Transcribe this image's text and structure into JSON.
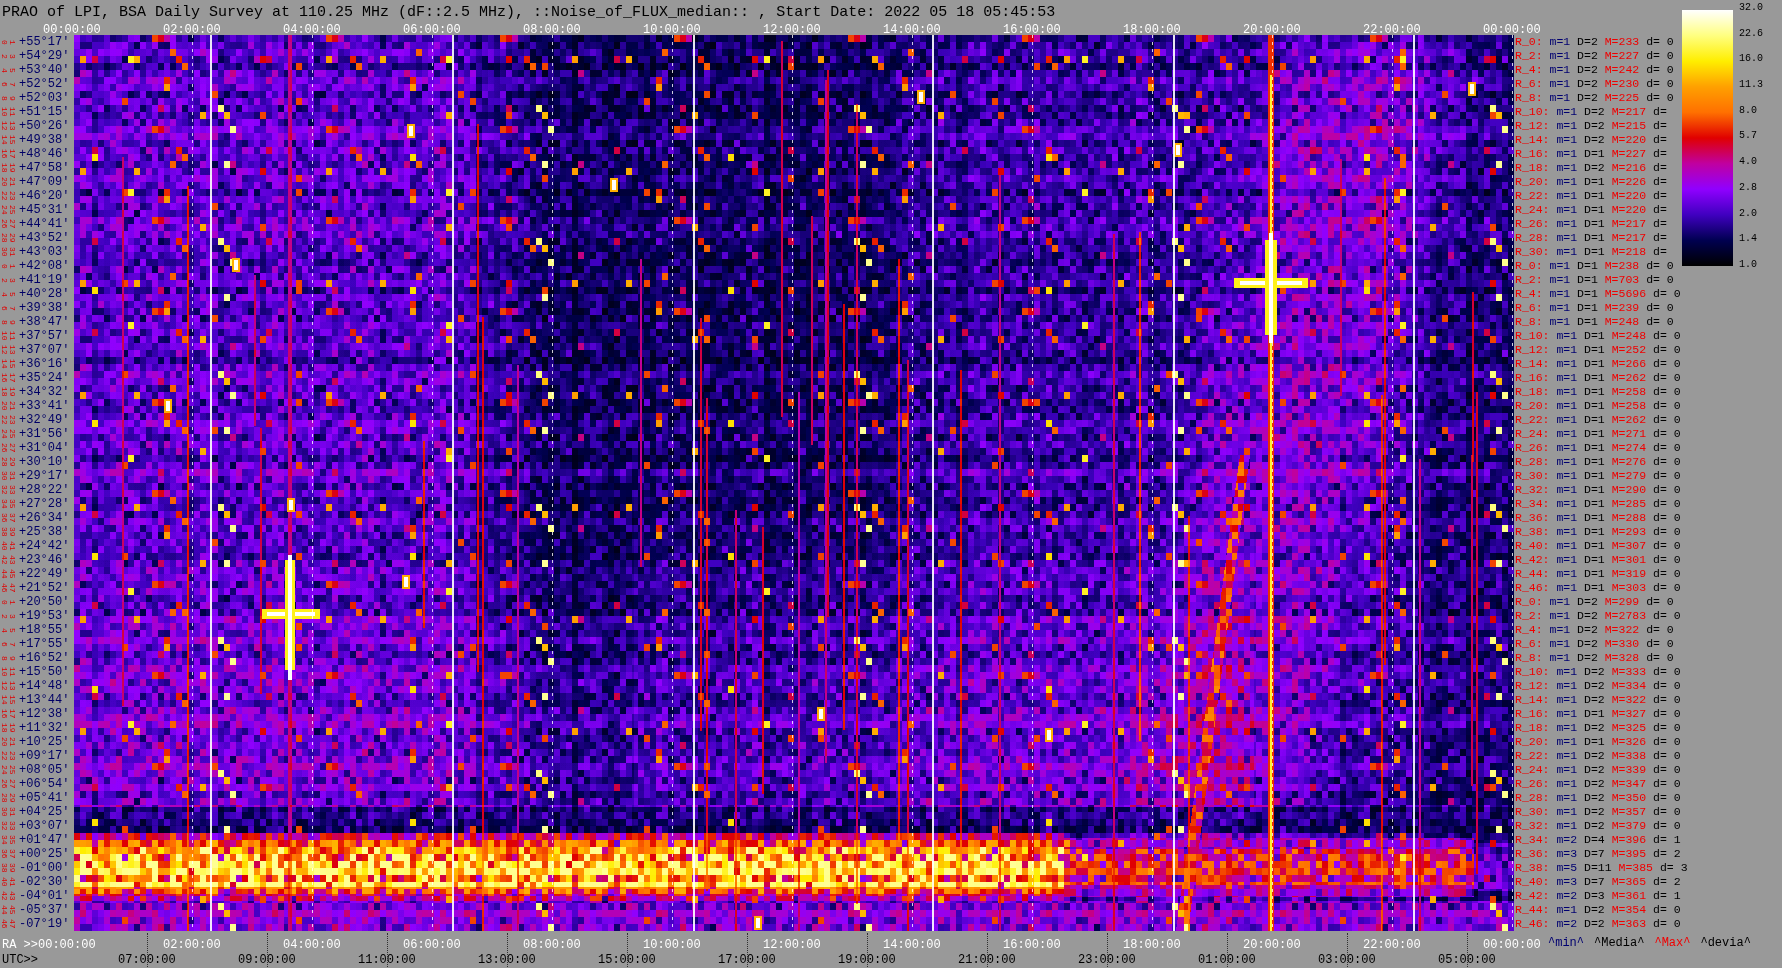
{
  "title": "PRAO of LPI, BSA Daily Survey at 110.25 MHz (dF::2.5 MHz), ::Noise_of_FLUX_median:: , Start Date: 2022 05 18 05:45:53",
  "top_axis": {
    "labels": [
      "00:00:00",
      "02:00:00",
      "04:00:00",
      "06:00:00",
      "08:00:00",
      "10:00:00",
      "12:00:00",
      "14:00:00",
      "16:00:00",
      "18:00:00",
      "20:00:00",
      "22:00:00",
      "00:00:00"
    ]
  },
  "rows": [
    {
      "numbers": [
        "0",
        "1"
      ],
      "declination": "+55°17′",
      "beam": "R_0:",
      "min": "m=1",
      "median": "D=2",
      "max": "M=233",
      "deviation": "d= 0"
    },
    {
      "numbers": [
        "2",
        "3"
      ],
      "declination": "+54°29′",
      "beam": "R_2:",
      "min": "m=1",
      "median": "D=2",
      "max": "M=227",
      "deviation": "d= 0"
    },
    {
      "numbers": [
        "4",
        "5"
      ],
      "declination": "+53°40′",
      "beam": "R_4:",
      "min": "m=1",
      "median": "D=2",
      "max": "M=242",
      "deviation": "d= 0"
    },
    {
      "numbers": [
        "6",
        "7"
      ],
      "declination": "+52°52′",
      "beam": "R_6:",
      "min": "m=1",
      "median": "D=2",
      "max": "M=230",
      "deviation": "d= 0"
    },
    {
      "numbers": [
        "8",
        "9"
      ],
      "declination": "+52°03′",
      "beam": "R_8:",
      "min": "m=1",
      "median": "D=2",
      "max": "M=225",
      "deviation": "d= 0"
    },
    {
      "numbers": [
        "10",
        "11"
      ],
      "declination": "+51°15′",
      "beam": "R_10:",
      "min": "m=1",
      "median": "D=2",
      "max": "M=217",
      "deviation": "d="
    },
    {
      "numbers": [
        "12",
        "13"
      ],
      "declination": "+50°26′",
      "beam": "R_12:",
      "min": "m=1",
      "median": "D=2",
      "max": "M=215",
      "deviation": "d="
    },
    {
      "numbers": [
        "14",
        "15"
      ],
      "declination": "+49°38′",
      "beam": "R_14:",
      "min": "m=1",
      "median": "D=2",
      "max": "M=220",
      "deviation": "d="
    },
    {
      "numbers": [
        "16",
        "17"
      ],
      "declination": "+48°46′",
      "beam": "R_16:",
      "min": "m=1",
      "median": "D=1",
      "max": "M=227",
      "deviation": "d="
    },
    {
      "numbers": [
        "18",
        "19"
      ],
      "declination": "+47°58′",
      "beam": "R_18:",
      "min": "m=1",
      "median": "D=2",
      "max": "M=216",
      "deviation": "d="
    },
    {
      "numbers": [
        "20",
        "21"
      ],
      "declination": "+47°09′",
      "beam": "R_20:",
      "min": "m=1",
      "median": "D=1",
      "max": "M=226",
      "deviation": "d="
    },
    {
      "numbers": [
        "22",
        "23"
      ],
      "declination": "+46°20′",
      "beam": "R_22:",
      "min": "m=1",
      "median": "D=1",
      "max": "M=220",
      "deviation": "d="
    },
    {
      "numbers": [
        "24",
        "25"
      ],
      "declination": "+45°31′",
      "beam": "R_24:",
      "min": "m=1",
      "median": "D=1",
      "max": "M=220",
      "deviation": "d="
    },
    {
      "numbers": [
        "26",
        "27"
      ],
      "declination": "+44°41′",
      "beam": "R_26:",
      "min": "m=1",
      "median": "D=1",
      "max": "M=217",
      "deviation": "d="
    },
    {
      "numbers": [
        "28",
        "29"
      ],
      "declination": "+43°52′",
      "beam": "R_28:",
      "min": "m=1",
      "median": "D=1",
      "max": "M=217",
      "deviation": "d="
    },
    {
      "numbers": [
        "30",
        "31"
      ],
      "declination": "+43°03′",
      "beam": "R_30:",
      "min": "m=1",
      "median": "D=1",
      "max": "M=218",
      "deviation": "d="
    },
    {
      "numbers": [
        "0",
        "1"
      ],
      "declination": "+42°08′",
      "beam": "R_0:",
      "min": "m=1",
      "median": "D=1",
      "max": "M=238",
      "deviation": "d= 0"
    },
    {
      "numbers": [
        "2",
        "3"
      ],
      "declination": "+41°19′",
      "beam": "R_2:",
      "min": "m=1",
      "median": "D=1",
      "max": "M=703",
      "deviation": "d= 0"
    },
    {
      "numbers": [
        "4",
        "5"
      ],
      "declination": "+40°28′",
      "beam": "R_4:",
      "min": "m=1",
      "median": "D=1",
      "max": "M=5696",
      "deviation": "d= 0"
    },
    {
      "numbers": [
        "6",
        "7"
      ],
      "declination": "+39°38′",
      "beam": "R_6:",
      "min": "m=1",
      "median": "D=1",
      "max": "M=239",
      "deviation": "d= 0"
    },
    {
      "numbers": [
        "8",
        "9"
      ],
      "declination": "+38°47′",
      "beam": "R_8:",
      "min": "m=1",
      "median": "D=1",
      "max": "M=248",
      "deviation": "d= 0"
    },
    {
      "numbers": [
        "10",
        "11"
      ],
      "declination": "+37°57′",
      "beam": "R_10:",
      "min": "m=1",
      "median": "D=1",
      "max": "M=248",
      "deviation": "d= 0"
    },
    {
      "numbers": [
        "12",
        "13"
      ],
      "declination": "+37°07′",
      "beam": "R_12:",
      "min": "m=1",
      "median": "D=1",
      "max": "M=252",
      "deviation": "d= 0"
    },
    {
      "numbers": [
        "14",
        "15"
      ],
      "declination": "+36°16′",
      "beam": "R_14:",
      "min": "m=1",
      "median": "D=1",
      "max": "M=266",
      "deviation": "d= 0"
    },
    {
      "numbers": [
        "16",
        "17"
      ],
      "declination": "+35°24′",
      "beam": "R_16:",
      "min": "m=1",
      "median": "D=1",
      "max": "M=262",
      "deviation": "d= 0"
    },
    {
      "numbers": [
        "18",
        "19"
      ],
      "declination": "+34°32′",
      "beam": "R_18:",
      "min": "m=1",
      "median": "D=1",
      "max": "M=258",
      "deviation": "d= 0"
    },
    {
      "numbers": [
        "20",
        "21"
      ],
      "declination": "+33°41′",
      "beam": "R_20:",
      "min": "m=1",
      "median": "D=1",
      "max": "M=258",
      "deviation": "d= 0"
    },
    {
      "numbers": [
        "22",
        "23"
      ],
      "declination": "+32°49′",
      "beam": "R_22:",
      "min": "m=1",
      "median": "D=1",
      "max": "M=262",
      "deviation": "d= 0"
    },
    {
      "numbers": [
        "24",
        "25"
      ],
      "declination": "+31°56′",
      "beam": "R_24:",
      "min": "m=1",
      "median": "D=1",
      "max": "M=271",
      "deviation": "d= 0"
    },
    {
      "numbers": [
        "26",
        "27"
      ],
      "declination": "+31°04′",
      "beam": "R_26:",
      "min": "m=1",
      "median": "D=1",
      "max": "M=274",
      "deviation": "d= 0"
    },
    {
      "numbers": [
        "28",
        "29"
      ],
      "declination": "+30°10′",
      "beam": "R_28:",
      "min": "m=1",
      "median": "D=1",
      "max": "M=276",
      "deviation": "d= 0"
    },
    {
      "numbers": [
        "30",
        "31"
      ],
      "declination": "+29°17′",
      "beam": "R_30:",
      "min": "m=1",
      "median": "D=1",
      "max": "M=279",
      "deviation": "d= 0"
    },
    {
      "numbers": [
        "32",
        "33"
      ],
      "declination": "+28°22′",
      "beam": "R_32:",
      "min": "m=1",
      "median": "D=1",
      "max": "M=290",
      "deviation": "d= 0"
    },
    {
      "numbers": [
        "34",
        "35"
      ],
      "declination": "+27°28′",
      "beam": "R_34:",
      "min": "m=1",
      "median": "D=1",
      "max": "M=285",
      "deviation": "d= 0"
    },
    {
      "numbers": [
        "36",
        "37"
      ],
      "declination": "+26°34′",
      "beam": "R_36:",
      "min": "m=1",
      "median": "D=1",
      "max": "M=288",
      "deviation": "d= 0"
    },
    {
      "numbers": [
        "38",
        "39"
      ],
      "declination": "+25°38′",
      "beam": "R_38:",
      "min": "m=1",
      "median": "D=1",
      "max": "M=293",
      "deviation": "d= 0"
    },
    {
      "numbers": [
        "40",
        "41"
      ],
      "declination": "+24°42′",
      "beam": "R_40:",
      "min": "m=1",
      "median": "D=1",
      "max": "M=307",
      "deviation": "d= 0"
    },
    {
      "numbers": [
        "42",
        "43"
      ],
      "declination": "+23°46′",
      "beam": "R_42:",
      "min": "m=1",
      "median": "D=1",
      "max": "M=301",
      "deviation": "d= 0"
    },
    {
      "numbers": [
        "44",
        "45"
      ],
      "declination": "+22°49′",
      "beam": "R_44:",
      "min": "m=1",
      "median": "D=1",
      "max": "M=319",
      "deviation": "d= 0"
    },
    {
      "numbers": [
        "46",
        "47"
      ],
      "declination": "+21°52′",
      "beam": "R_46:",
      "min": "m=1",
      "median": "D=1",
      "max": "M=303",
      "deviation": "d= 0"
    },
    {
      "numbers": [
        "0",
        "1"
      ],
      "declination": "+20°50′",
      "beam": "R_0:",
      "min": "m=1",
      "median": "D=2",
      "max": "M=299",
      "deviation": "d= 0"
    },
    {
      "numbers": [
        "2",
        "3"
      ],
      "declination": "+19°53′",
      "beam": "R_2:",
      "min": "m=1",
      "median": "D=2",
      "max": "M=2783",
      "deviation": "d= 0"
    },
    {
      "numbers": [
        "4",
        "5"
      ],
      "declination": "+18°55′",
      "beam": "R_4:",
      "min": "m=1",
      "median": "D=2",
      "max": "M=322",
      "deviation": "d= 0"
    },
    {
      "numbers": [
        "6",
        "7"
      ],
      "declination": "+17°55′",
      "beam": "R_6:",
      "min": "m=1",
      "median": "D=2",
      "max": "M=330",
      "deviation": "d= 0"
    },
    {
      "numbers": [
        "8",
        "9"
      ],
      "declination": "+16°52′",
      "beam": "R_8:",
      "min": "m=1",
      "median": "D=2",
      "max": "M=328",
      "deviation": "d= 0"
    },
    {
      "numbers": [
        "10",
        "11"
      ],
      "declination": "+15°50′",
      "beam": "R_10:",
      "min": "m=1",
      "median": "D=2",
      "max": "M=333",
      "deviation": "d= 0"
    },
    {
      "numbers": [
        "12",
        "13"
      ],
      "declination": "+14°48′",
      "beam": "R_12:",
      "min": "m=1",
      "median": "D=2",
      "max": "M=334",
      "deviation": "d= 0"
    },
    {
      "numbers": [
        "14",
        "15"
      ],
      "declination": "+13°44′",
      "beam": "R_14:",
      "min": "m=1",
      "median": "D=2",
      "max": "M=322",
      "deviation": "d= 0"
    },
    {
      "numbers": [
        "16",
        "17"
      ],
      "declination": "+12°38′",
      "beam": "R_16:",
      "min": "m=1",
      "median": "D=1",
      "max": "M=327",
      "deviation": "d= 0"
    },
    {
      "numbers": [
        "18",
        "19"
      ],
      "declination": "+11°32′",
      "beam": "R_18:",
      "min": "m=1",
      "median": "D=2",
      "max": "M=325",
      "deviation": "d= 0"
    },
    {
      "numbers": [
        "20",
        "21"
      ],
      "declination": "+10°25′",
      "beam": "R_20:",
      "min": "m=1",
      "median": "D=1",
      "max": "M=326",
      "deviation": "d= 0"
    },
    {
      "numbers": [
        "22",
        "23"
      ],
      "declination": "+09°17′",
      "beam": "R_22:",
      "min": "m=1",
      "median": "D=2",
      "max": "M=338",
      "deviation": "d= 0"
    },
    {
      "numbers": [
        "24",
        "25"
      ],
      "declination": "+08°05′",
      "beam": "R_24:",
      "min": "m=1",
      "median": "D=2",
      "max": "M=339",
      "deviation": "d= 0"
    },
    {
      "numbers": [
        "26",
        "27"
      ],
      "declination": "+06°54′",
      "beam": "R_26:",
      "min": "m=1",
      "median": "D=2",
      "max": "M=347",
      "deviation": "d= 0"
    },
    {
      "numbers": [
        "28",
        "29"
      ],
      "declination": "+05°41′",
      "beam": "R_28:",
      "min": "m=1",
      "median": "D=2",
      "max": "M=350",
      "deviation": "d= 0"
    },
    {
      "numbers": [
        "30",
        "31"
      ],
      "declination": "+04°25′",
      "beam": "R_30:",
      "min": "m=1",
      "median": "D=2",
      "max": "M=357",
      "deviation": "d= 0"
    },
    {
      "numbers": [
        "32",
        "33"
      ],
      "declination": "+03°07′",
      "beam": "R_32:",
      "min": "m=1",
      "median": "D=2",
      "max": "M=379",
      "deviation": "d= 0"
    },
    {
      "numbers": [
        "34",
        "35"
      ],
      "declination": "+01°47′",
      "beam": "R_34:",
      "min": "m=2",
      "median": "D=4",
      "max": "M=396",
      "deviation": "d= 1"
    },
    {
      "numbers": [
        "36",
        "37"
      ],
      "declination": "+00°25′",
      "beam": "R_36:",
      "min": "m=3",
      "median": "D=7",
      "max": "M=395",
      "deviation": "d= 2"
    },
    {
      "numbers": [
        "38",
        "39"
      ],
      "declination": "-01°00′",
      "beam": "R_38:",
      "min": "m=5",
      "median": "D=11",
      "max": "M=385",
      "deviation": "d= 3"
    },
    {
      "numbers": [
        "40",
        "41"
      ],
      "declination": "-02°30′",
      "beam": "R_40:",
      "min": "m=3",
      "median": "D=7",
      "max": "M=365",
      "deviation": "d= 2"
    },
    {
      "numbers": [
        "42",
        "43"
      ],
      "declination": "-04°01′",
      "beam": "R_42:",
      "min": "m=2",
      "median": "D=3",
      "max": "M=361",
      "deviation": "d= 1"
    },
    {
      "numbers": [
        "44",
        "45"
      ],
      "declination": "-05°37′",
      "beam": "R_44:",
      "min": "m=1",
      "median": "D=2",
      "max": "M=354",
      "deviation": "d= 0"
    },
    {
      "numbers": [
        "46",
        "47"
      ],
      "declination": "-07°19′",
      "beam": "R_46:",
      "min": "m=2",
      "median": "D=2",
      "max": "M=363",
      "deviation": "d= 0"
    }
  ],
  "colorbar": {
    "ticks": [
      "32.0",
      "22.6",
      "16.0",
      "11.3",
      "8.0",
      "5.7",
      "4.0",
      "2.8",
      "2.0",
      "1.4",
      "1.0"
    ]
  },
  "bottom_axis": {
    "ra_labels": [
      "RA >>00:00:00",
      "02:00:00",
      "04:00:00",
      "06:00:00",
      "08:00:00",
      "10:00:00",
      "12:00:00",
      "14:00:00",
      "16:00:00",
      "18:00:00",
      "20:00:00",
      "22:00:00",
      "00:00:00"
    ],
    "utc_prefix": "UTC>>",
    "utc_labels": [
      "07:00:00",
      "09:00:00",
      "11:00:00",
      "13:00:00",
      "15:00:00",
      "17:00:00",
      "19:00:00",
      "21:00:00",
      "23:00:00",
      "01:00:00",
      "03:00:00",
      "05:00:00"
    ],
    "legend": [
      {
        "kind": "min",
        "text": "^min^"
      },
      {
        "kind": "median",
        "text": "^Media^"
      },
      {
        "kind": "max",
        "text": "^Max^"
      },
      {
        "kind": "deviation",
        "text": "^devia^"
      }
    ]
  }
}
